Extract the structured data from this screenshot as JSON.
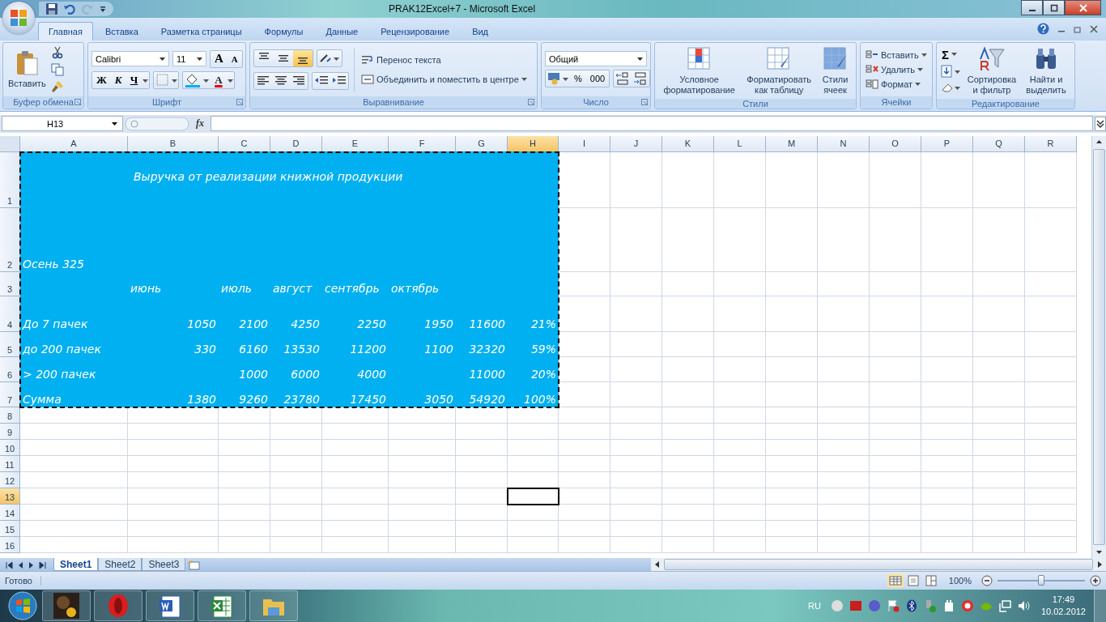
{
  "window": {
    "title": "PRAK12Excel+7 - Microsoft Excel"
  },
  "tabs": [
    {
      "label": "Главная",
      "selected": true
    },
    {
      "label": "Вставка",
      "selected": false
    },
    {
      "label": "Разметка страницы",
      "selected": false
    },
    {
      "label": "Формулы",
      "selected": false
    },
    {
      "label": "Данные",
      "selected": false
    },
    {
      "label": "Рецензирование",
      "selected": false
    },
    {
      "label": "Вид",
      "selected": false
    }
  ],
  "ribbon": {
    "clipboard": {
      "label": "Буфер обмена",
      "paste": "Вставить"
    },
    "font": {
      "label": "Шрифт",
      "font_name": "Calibri",
      "font_size": "11",
      "grow": "A",
      "shrink": "A",
      "bold": "Ж",
      "italic": "К",
      "underline": "Ч",
      "font_color": "A"
    },
    "alignment": {
      "label": "Выравнивание",
      "vertical_align": [
        {
          "selected": false
        },
        {
          "selected": false
        },
        {
          "selected": true
        }
      ],
      "wrap_text": "Перенос текста",
      "merge_center": "Объединить и поместить в центре"
    },
    "number": {
      "label": "Число",
      "format": "Общий",
      "percent": "%",
      "thousands": "000"
    },
    "styles": {
      "label": "Стили",
      "buttons": [
        "Условное форматирование",
        "Форматировать как таблицу",
        "Стили ячеек"
      ]
    },
    "cells": {
      "label": "Ячейки",
      "buttons": [
        "Вставить",
        "Удалить",
        "Формат"
      ]
    },
    "editing": {
      "label": "Редактирование",
      "sum": "Σ",
      "buttons": [
        "Сортировка и фильтр",
        "Найти и выделить"
      ]
    }
  },
  "formula_bar": {
    "name_box": "H13",
    "fx": "fx"
  },
  "sheet": {
    "copy_marquee": true,
    "columns": [
      {
        "name": "A",
        "selected": false
      },
      {
        "name": "B",
        "selected": false
      },
      {
        "name": "C",
        "selected": false
      },
      {
        "name": "D",
        "selected": false
      },
      {
        "name": "E",
        "selected": false
      },
      {
        "name": "F",
        "selected": false
      },
      {
        "name": "G",
        "selected": false
      },
      {
        "name": "H",
        "selected": true
      },
      {
        "name": "I",
        "selected": false
      },
      {
        "name": "J",
        "selected": false
      },
      {
        "name": "K",
        "selected": false
      },
      {
        "name": "L",
        "selected": false
      },
      {
        "name": "M",
        "selected": false
      },
      {
        "name": "N",
        "selected": false
      },
      {
        "name": "O",
        "selected": false
      },
      {
        "name": "P",
        "selected": false
      },
      {
        "name": "Q",
        "selected": false
      },
      {
        "name": "R",
        "selected": false
      }
    ],
    "rows": [
      {
        "number": "1",
        "selected": false,
        "filled": true,
        "kind": "title",
        "cells": [
          "",
          "Выручка от реализации книжной продукции"
        ]
      },
      {
        "number": "2",
        "selected": false,
        "filled": true,
        "kind": "text",
        "cells": [
          "Осень 325"
        ]
      },
      {
        "number": "3",
        "selected": false,
        "filled": true,
        "kind": "text",
        "cells": [
          "",
          "июнь",
          "июль",
          "август",
          "сентябрь",
          "октябрь"
        ]
      },
      {
        "number": "4",
        "selected": false,
        "filled": true,
        "kind": "data",
        "cells": [
          "До 7 пачек",
          "1050",
          "2100",
          "4250",
          "2250",
          "1950",
          "11600",
          "21%"
        ]
      },
      {
        "number": "5",
        "selected": false,
        "filled": true,
        "kind": "data",
        "cells": [
          "до 200 пачек",
          "330",
          "6160",
          "13530",
          "11200",
          "1100",
          "32320",
          "59%"
        ]
      },
      {
        "number": "6",
        "selected": false,
        "filled": true,
        "kind": "data",
        "cells": [
          "> 200 пачек",
          "",
          "1000",
          "6000",
          "4000",
          "",
          "11000",
          "20%"
        ]
      },
      {
        "number": "7",
        "selected": false,
        "filled": true,
        "kind": "data",
        "cells": [
          "Сумма",
          "1380",
          "9260",
          "23780",
          "17450",
          "3050",
          "54920",
          "100%"
        ]
      },
      {
        "number": "8",
        "selected": false
      },
      {
        "number": "9",
        "selected": false
      },
      {
        "number": "10",
        "selected": false
      },
      {
        "number": "11",
        "selected": false
      },
      {
        "number": "12",
        "selected": false
      },
      {
        "number": "13",
        "selected": true
      },
      {
        "number": "14",
        "selected": false
      },
      {
        "number": "15",
        "selected": false
      },
      {
        "number": "16",
        "selected": false
      }
    ]
  },
  "sheet_tabs": [
    {
      "label": "Sheet1",
      "selected": true
    },
    {
      "label": "Sheet2",
      "selected": false
    },
    {
      "label": "Sheet3",
      "selected": false
    }
  ],
  "status_bar": {
    "text": "Готово",
    "zoom": "100%",
    "zoom_slider": {
      "level": 0.5
    }
  },
  "taskbar": {
    "apps": [
      {
        "kind": "picture"
      },
      {
        "kind": "browser"
      },
      {
        "kind": "document"
      },
      {
        "kind": "spreadsheet"
      },
      {
        "kind": "folder"
      }
    ],
    "language": "RU",
    "time": "17:49",
    "date": "10.02.2012"
  }
}
